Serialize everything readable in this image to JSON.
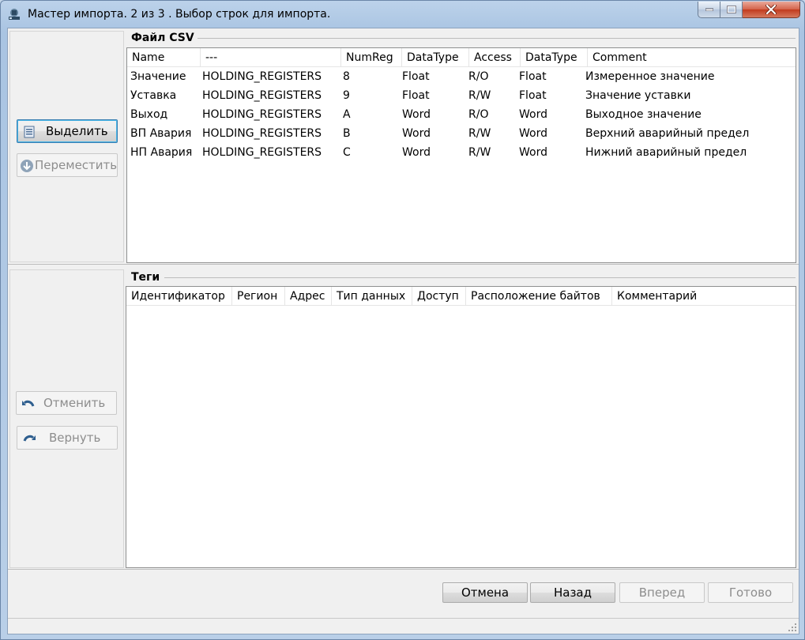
{
  "window": {
    "title": "Мастер импорта. 2 из 3 . Выбор строк для импорта."
  },
  "csv_section": {
    "title": "Файл CSV",
    "columns": [
      "Name",
      "---",
      "NumReg",
      "DataType",
      "Access",
      "DataType",
      "Comment"
    ],
    "rows": [
      [
        "Значение",
        "HOLDING_REGISTERS",
        "8",
        "Float",
        "R/O",
        "Float",
        "Измеренное значение"
      ],
      [
        "Уставка",
        "HOLDING_REGISTERS",
        "9",
        "Float",
        "R/W",
        "Float",
        "Значение уставки"
      ],
      [
        "Выход",
        "HOLDING_REGISTERS",
        "A",
        "Word",
        "R/O",
        "Word",
        "Выходное значение"
      ],
      [
        "ВП Авария",
        "HOLDING_REGISTERS",
        "B",
        "Word",
        "R/W",
        "Word",
        "Верхний аварийный предел"
      ],
      [
        "НП Авария",
        "HOLDING_REGISTERS",
        "C",
        "Word",
        "R/W",
        "Word",
        "Нижний аварийный предел"
      ]
    ]
  },
  "tags_section": {
    "title": "Теги",
    "columns": [
      "Идентификатор",
      "Регион",
      "Адрес",
      "Тип данных",
      "Доступ",
      "Расположение байтов",
      "Комментарий"
    ]
  },
  "left_buttons": {
    "select": "Выделить",
    "move": "Переместить",
    "undo": "Отменить",
    "redo": "Вернуть"
  },
  "footer_buttons": {
    "cancel": "Отмена",
    "back": "Назад",
    "next": "Вперед",
    "finish": "Готово"
  },
  "icons": {
    "app": "opc-server-icon",
    "select": "list-select-icon",
    "move": "arrow-down-circle-icon",
    "undo": "undo-arrow-icon",
    "redo": "redo-arrow-icon"
  }
}
